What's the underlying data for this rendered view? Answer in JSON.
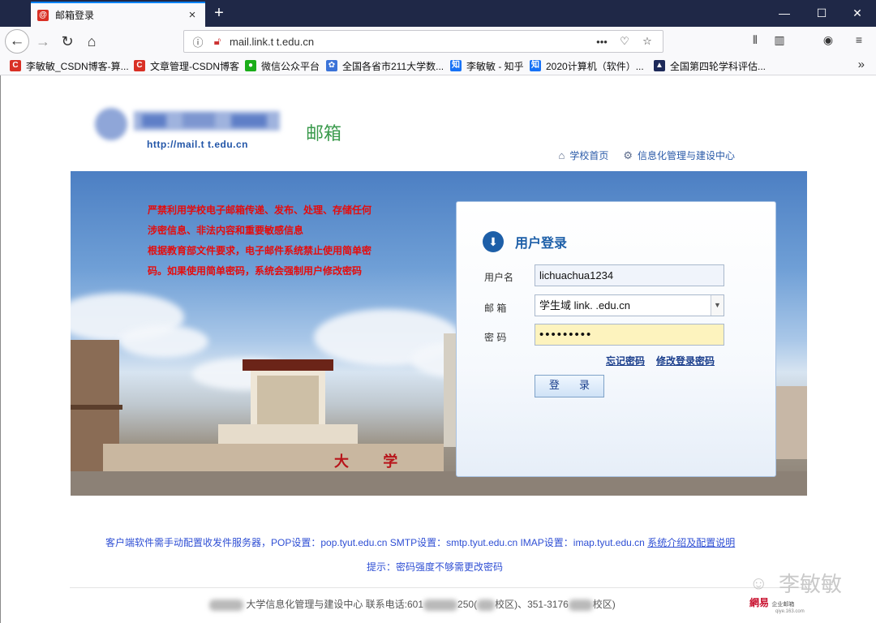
{
  "browser": {
    "tab": {
      "title": "邮箱登录",
      "favicon": "@",
      "close": "×"
    },
    "new_tab": "+",
    "window": {
      "minimize": "—",
      "maximize": "☐",
      "close": "✕"
    },
    "url": "mail.link.t  t.edu.cn",
    "url_dots": "•••",
    "bookmarks": [
      {
        "label": "李敏敏_CSDN博客-算...",
        "icon": "csdn-icon",
        "color": "#d93025",
        "glyph": "C"
      },
      {
        "label": "文章管理-CSDN博客",
        "icon": "csdn-icon",
        "color": "#d93025",
        "glyph": "C"
      },
      {
        "label": "微信公众平台",
        "icon": "wechat-icon",
        "color": "#1aad19",
        "glyph": "●"
      },
      {
        "label": "全国各省市211大学数...",
        "icon": "paw-icon",
        "color": "#3b73d8",
        "glyph": "✿"
      },
      {
        "label": "李敏敏 - 知乎",
        "icon": "zhihu-icon",
        "color": "#1772f6",
        "glyph": "知"
      },
      {
        "label": "2020计算机（软件）...",
        "icon": "zhihu-icon",
        "color": "#1772f6",
        "glyph": "知"
      },
      {
        "label": "全国第四轮学科评估...",
        "icon": "graduation-cap-icon",
        "color": "#1e2a5a",
        "glyph": "▲"
      }
    ],
    "bookmarks_more": "»"
  },
  "header": {
    "logo_url": "http://mail.t  t.edu.cn",
    "logo_mail": "邮箱",
    "links": [
      {
        "label": "学校首页",
        "icon": "home-icon"
      },
      {
        "label": "信息化管理与建设中心",
        "icon": "network-icon"
      }
    ]
  },
  "notice": [
    "严禁利用学校电子邮箱传递、发布、处理、存储任何",
    "涉密信息、非法内容和重要敏感信息",
    "根据教育部文件要求，电子邮件系统禁止使用简单密",
    "码。如果使用简单密码，系统会强制用户修改密码"
  ],
  "banner_sign": "大 学",
  "login": {
    "title": "用户登录",
    "username_label": "用户名",
    "username_value": "lichuachua1234",
    "domain_label": "邮 箱",
    "domain_value": "学生域 link.  .edu.cn",
    "password_label": "密 码",
    "password_value": "•••••••••",
    "forgot": "忘记密码",
    "change": "修改登录密码",
    "submit": "登 录"
  },
  "info": {
    "line1": "客户端软件需手动配置收发件服务器，POP设置：pop.tyut.edu.cn    SMTP设置：smtp.tyut.edu.cn  IMAP设置：imap.tyut.edu.cn",
    "line1_link": "系统介绍及配置说明",
    "hint": "提示：密码强度不够需更改密码"
  },
  "footer": {
    "part1": "大学信息化管理与建设中心  联系电话:601",
    "part2": "250(",
    "part3": "校区)、",
    "part4": "351-3176",
    "part5": "校区)"
  },
  "watermark": "李敏敏",
  "brand": {
    "name": "網易",
    "sub": "企业邮箱",
    "domain": "qiye.163.com"
  }
}
